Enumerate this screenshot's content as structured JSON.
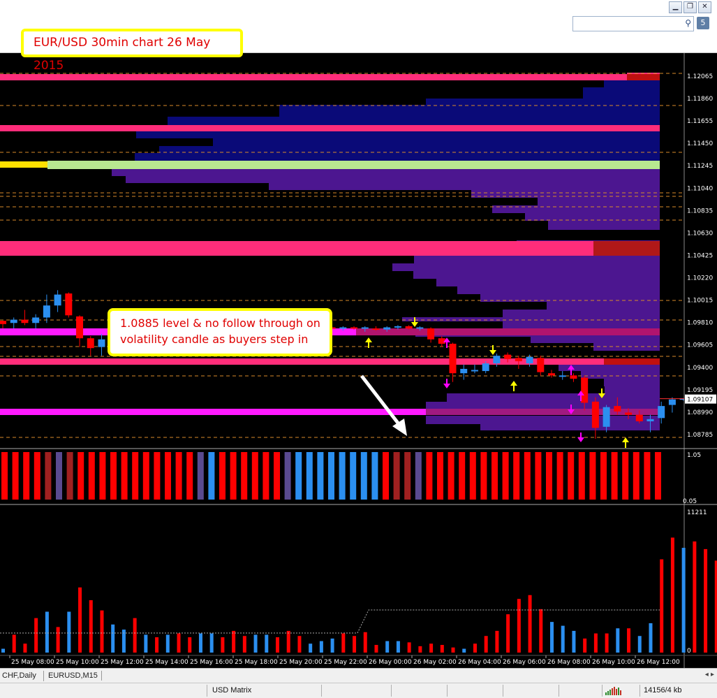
{
  "window": {
    "buttons": [
      {
        "name": "minimize-button",
        "glyph": "▁"
      },
      {
        "name": "restore-button",
        "glyph": "❐"
      },
      {
        "name": "close-button",
        "glyph": "✕"
      }
    ],
    "search_icon": "search-icon",
    "help_icon": "5"
  },
  "annotation_title": "EUR/USD 30min chart 26 May 2015",
  "note": {
    "line1": "1.0885 level & no follow through on",
    "line2": "volatility candle as buyers step in"
  },
  "colors": {
    "up_candle": "#2b8ff0",
    "down_candle": "#ff0000",
    "pink_level": "#ff2d7a",
    "magenta_level": "#ff1aff",
    "navy": "#0a0a78",
    "purple": "#4c1690",
    "violet": "#6a1fb0",
    "arrow_buy": "#ffff00",
    "arrow_sell": "#ff00ff"
  },
  "chart_data": {
    "type": "candlestick",
    "symbol": "EUR/USD",
    "timeframe": "30min",
    "price_ticks": [
      "1.12065",
      "1.11860",
      "1.11655",
      "1.11450",
      "1.11245",
      "1.11040",
      "1.10835",
      "1.10630",
      "1.10425",
      "1.10220",
      "1.10015",
      "1.09810",
      "1.09605",
      "1.09400",
      "1.09195",
      "1.09107",
      "1.08990",
      "1.08785"
    ],
    "current_price": "1.09107",
    "ylim": [
      1.0878,
      1.1212
    ],
    "time_labels": [
      "25 May 08:00",
      "25 May 10:00",
      "25 May 12:00",
      "25 May 14:00",
      "25 May 16:00",
      "25 May 18:00",
      "25 May 20:00",
      "25 May 22:00",
      "26 May 00:00",
      "26 May 02:00",
      "26 May 04:00",
      "26 May 06:00",
      "26 May 08:00",
      "26 May 10:00",
      "26 May 12:00"
    ],
    "candles": [
      [
        1.0982,
        1.0982,
        1.0975,
        1.0979
      ],
      [
        1.098,
        1.0985,
        1.0975,
        1.0983
      ],
      [
        1.0983,
        1.0992,
        1.0978,
        1.098
      ],
      [
        1.098,
        1.0988,
        1.0975,
        1.0985
      ],
      [
        1.0985,
        1.1006,
        1.098,
        1.0996
      ],
      [
        1.0996,
        1.101,
        1.099,
        1.1006
      ],
      [
        1.1007,
        1.1008,
        1.0985,
        1.0987
      ],
      [
        1.0986,
        1.0987,
        1.0958,
        1.0966
      ],
      [
        1.0966,
        1.0968,
        1.095,
        1.0957
      ],
      [
        1.0958,
        1.097,
        1.095,
        1.0965
      ],
      [
        1.0965,
        1.0975,
        1.096,
        1.0972
      ],
      [
        1.0972,
        1.098,
        1.0962,
        1.0968
      ],
      [
        1.0968,
        1.0975,
        1.0962,
        1.0972
      ],
      [
        1.0972,
        1.0978,
        1.0965,
        1.0975
      ],
      [
        1.0975,
        1.098,
        1.097,
        1.0972
      ],
      [
        1.0972,
        1.0976,
        1.0966,
        1.0975
      ],
      [
        1.0975,
        1.0978,
        1.097,
        1.0972
      ],
      [
        1.0972,
        1.0982,
        1.0968,
        1.0978
      ],
      [
        1.0978,
        1.099,
        1.0974,
        1.0984
      ],
      [
        1.0984,
        1.0986,
        1.098,
        1.0982
      ],
      [
        1.0984,
        1.0986,
        1.096,
        1.0962
      ],
      [
        1.0962,
        1.0968,
        1.0956,
        1.0964
      ],
      [
        1.0964,
        1.097,
        1.0958,
        1.0966
      ],
      [
        1.0968,
        1.097,
        1.0962,
        1.0962
      ],
      [
        1.0962,
        1.097,
        1.096,
        1.0966
      ],
      [
        1.0967,
        1.0988,
        1.0964,
        1.0983
      ],
      [
        1.0985,
        1.0988,
        1.0978,
        1.098
      ],
      [
        1.098,
        1.0982,
        1.097,
        1.0972
      ],
      [
        1.0972,
        1.098,
        1.097,
        1.0978
      ],
      [
        1.0977,
        1.0978,
        1.0975,
        1.0976
      ],
      [
        1.0976,
        1.0977,
        1.0974,
        1.0975
      ],
      [
        1.0975,
        1.0977,
        1.0973,
        1.0976
      ],
      [
        1.0976,
        1.0977,
        1.0974,
        1.0975
      ],
      [
        1.0975,
        1.0977,
        1.0972,
        1.0976
      ],
      [
        1.0975,
        1.0977,
        1.0973,
        1.0974
      ],
      [
        1.0974,
        1.0977,
        1.0972,
        1.0976
      ],
      [
        1.0976,
        1.0978,
        1.0974,
        1.0977
      ],
      [
        1.0977,
        1.0978,
        1.0974,
        1.0975
      ],
      [
        1.0975,
        1.0977,
        1.0973,
        1.0976
      ],
      [
        1.0975,
        1.0976,
        1.0962,
        1.0965
      ],
      [
        1.0966,
        1.0968,
        1.0958,
        1.0961
      ],
      [
        1.0961,
        1.0962,
        1.0926,
        1.0934
      ],
      [
        1.0934,
        1.0942,
        1.0928,
        1.0938
      ],
      [
        1.0937,
        1.0942,
        1.0934,
        1.0937
      ],
      [
        1.0936,
        1.0945,
        1.0934,
        1.0943
      ],
      [
        1.0943,
        1.0952,
        1.094,
        1.095
      ],
      [
        1.0951,
        1.0953,
        1.0944,
        1.0947
      ],
      [
        1.0948,
        1.095,
        1.0938,
        1.0945
      ],
      [
        1.0943,
        1.0951,
        1.094,
        1.0949
      ],
      [
        1.0948,
        1.095,
        1.0932,
        1.0935
      ],
      [
        1.0934,
        1.0937,
        1.093,
        1.0932
      ],
      [
        1.0932,
        1.0936,
        1.0928,
        1.0932
      ],
      [
        1.0932,
        1.0934,
        1.0926,
        1.0929
      ],
      [
        1.093,
        1.0932,
        1.09,
        1.0907
      ],
      [
        1.0908,
        1.0912,
        1.0874,
        1.0884
      ],
      [
        1.0885,
        1.0905,
        1.088,
        1.0903
      ],
      [
        1.0904,
        1.0912,
        1.0896,
        1.0899
      ],
      [
        1.0898,
        1.0902,
        1.0892,
        1.0896
      ],
      [
        1.0896,
        1.09,
        1.0888,
        1.089
      ],
      [
        1.089,
        1.0896,
        1.088,
        1.0892
      ],
      [
        1.0893,
        1.0908,
        1.0888,
        1.0904
      ],
      [
        1.0905,
        1.0912,
        1.0898,
        1.091
      ],
      [
        1.091,
        1.0911,
        1.0909,
        1.0911
      ]
    ],
    "volume_label_max": "11211",
    "volume_label_min": "0",
    "volumes": [
      [
        300,
        0
      ],
      [
        1400,
        1
      ],
      [
        700,
        1
      ],
      [
        2700,
        1
      ],
      [
        3200,
        0
      ],
      [
        2000,
        1
      ],
      [
        3200,
        0
      ],
      [
        5100,
        1
      ],
      [
        4100,
        1
      ],
      [
        3300,
        1
      ],
      [
        2200,
        0
      ],
      [
        1800,
        0
      ],
      [
        2700,
        1
      ],
      [
        1400,
        0
      ],
      [
        1200,
        1
      ],
      [
        1400,
        0
      ],
      [
        1500,
        1
      ],
      [
        1200,
        1
      ],
      [
        1500,
        0
      ],
      [
        1500,
        0
      ],
      [
        1200,
        1
      ],
      [
        1700,
        1
      ],
      [
        1300,
        1
      ],
      [
        1400,
        0
      ],
      [
        1400,
        0
      ],
      [
        1200,
        1
      ],
      [
        1700,
        1
      ],
      [
        1300,
        1
      ],
      [
        700,
        0
      ],
      [
        900,
        0
      ],
      [
        1100,
        0
      ],
      [
        1500,
        1
      ],
      [
        1300,
        1
      ],
      [
        1600,
        1
      ],
      [
        600,
        1
      ],
      [
        900,
        0
      ],
      [
        900,
        0
      ],
      [
        800,
        1
      ],
      [
        500,
        1
      ],
      [
        700,
        1
      ],
      [
        600,
        1
      ],
      [
        400,
        1
      ],
      [
        300,
        0
      ],
      [
        700,
        1
      ],
      [
        1300,
        1
      ],
      [
        1700,
        1
      ],
      [
        3000,
        1
      ],
      [
        4200,
        1
      ],
      [
        4500,
        1
      ],
      [
        3400,
        1
      ],
      [
        2400,
        0
      ],
      [
        2100,
        0
      ],
      [
        1700,
        0
      ],
      [
        1100,
        1
      ],
      [
        1500,
        1
      ],
      [
        1500,
        1
      ],
      [
        1900,
        0
      ],
      [
        1900,
        1
      ],
      [
        1300,
        0
      ],
      [
        2300,
        0
      ],
      [
        7300,
        1
      ],
      [
        9000,
        1
      ],
      [
        8200,
        0
      ],
      [
        8700,
        1
      ],
      [
        8100,
        1
      ],
      [
        7200,
        1
      ],
      [
        6900,
        1
      ],
      [
        5600,
        0
      ],
      [
        5500,
        0
      ],
      [
        0,
        1
      ]
    ],
    "matrix_label_top": "1.05",
    "matrix_label_bottom": "0.05"
  },
  "tabs": [
    "CHF,Daily",
    "EURUSD,M15"
  ],
  "status": {
    "profile": "USD Matrix",
    "traffic": "14156/4 kb"
  }
}
